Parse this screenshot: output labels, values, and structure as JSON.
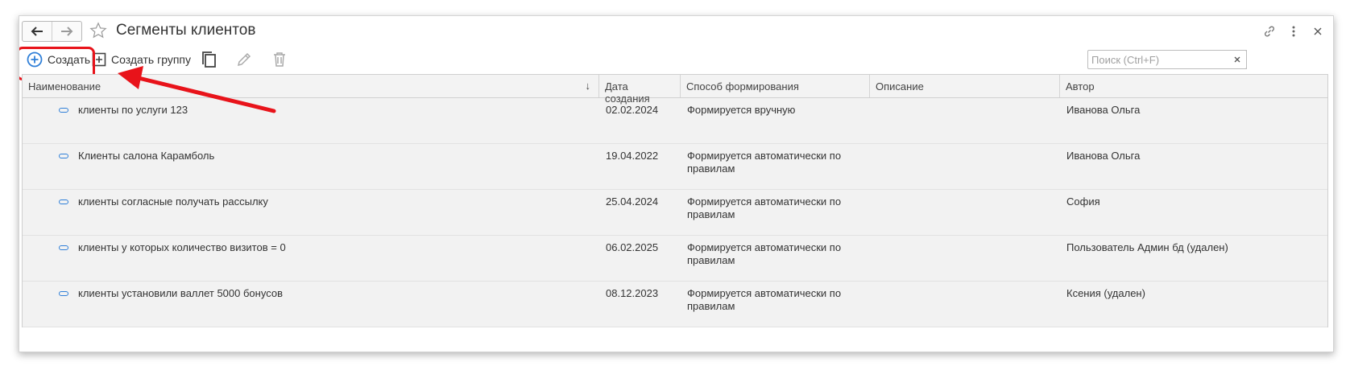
{
  "window": {
    "title": "Сегменты клиентов"
  },
  "toolbar": {
    "create_label": "Создать",
    "create_group_label": "Создать группу",
    "search_placeholder": "Поиск (Ctrl+F)",
    "search_value": ""
  },
  "table": {
    "columns": [
      "Наименование",
      "Дата создания",
      "Способ формирования",
      "Описание",
      "Автор"
    ],
    "sort_indicator": "↓",
    "rows": [
      {
        "name": "клиенты по услуги 123",
        "date": "02.02.2024",
        "method": "Формируется вручную",
        "description": "",
        "author": "Иванова Ольга"
      },
      {
        "name": "Клиенты салона Карамболь",
        "date": "19.04.2022",
        "method": "Формируется автоматически по правилам",
        "description": "",
        "author": "Иванова Ольга"
      },
      {
        "name": "клиенты согласные получать рассылку",
        "date": "25.04.2024",
        "method": "Формируется автоматически по правилам",
        "description": "",
        "author": "София"
      },
      {
        "name": "клиенты у которых количество визитов = 0",
        "date": "06.02.2025",
        "method": "Формируется автоматически по правилам",
        "description": "",
        "author": "Пользователь Админ бд (удален)"
      },
      {
        "name": "клиенты установили валлет 5000 бонусов",
        "date": "08.12.2023",
        "method": "Формируется автоматически по правилам",
        "description": "",
        "author": "Ксения (удален)"
      }
    ]
  },
  "colors": {
    "accent": "#2f7fd8",
    "annotation": "#e8131a"
  },
  "icons": [
    "back-arrow-icon",
    "forward-arrow-icon",
    "star-icon",
    "link-icon",
    "more-icon",
    "close-icon",
    "plus-circle-icon",
    "plus-square-icon",
    "copy-icon",
    "pencil-icon",
    "trash-icon",
    "item-icon"
  ]
}
